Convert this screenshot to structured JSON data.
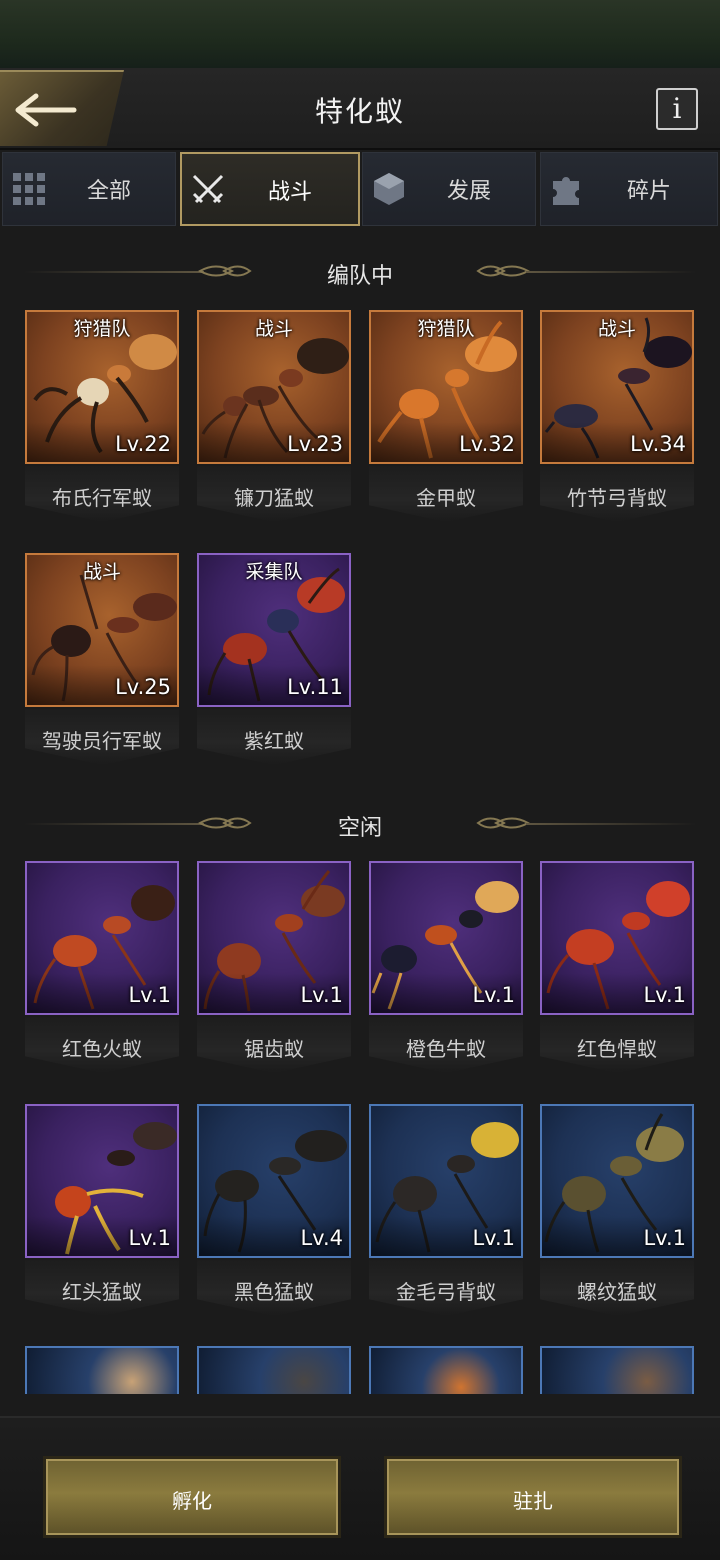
{
  "header": {
    "title": "特化蚁",
    "info_label": "i",
    "back_icon": "back-arrow-icon"
  },
  "tabs": [
    {
      "label": "全部",
      "icon": "grid-icon",
      "active": false
    },
    {
      "label": "战斗",
      "icon": "crossed-swords-icon",
      "active": true
    },
    {
      "label": "发展",
      "icon": "cube-icon",
      "active": false
    },
    {
      "label": "碎片",
      "icon": "puzzle-icon",
      "active": false
    }
  ],
  "sections": {
    "in_team": {
      "title": "编队中"
    },
    "idle": {
      "title": "空闲"
    }
  },
  "in_team_ants": [
    {
      "tag": "狩猎队",
      "level": "Lv.22",
      "name": "布氏行军蚁",
      "rarity": "orange"
    },
    {
      "tag": "战斗",
      "level": "Lv.23",
      "name": "镰刀猛蚁",
      "rarity": "orange"
    },
    {
      "tag": "狩猎队",
      "level": "Lv.32",
      "name": "金甲蚁",
      "rarity": "orange"
    },
    {
      "tag": "战斗",
      "level": "Lv.34",
      "name": "竹节弓背蚁",
      "rarity": "orange"
    },
    {
      "tag": "战斗",
      "level": "Lv.25",
      "name": "驾驶员行军蚁",
      "rarity": "orange"
    },
    {
      "tag": "采集队",
      "level": "Lv.11",
      "name": "紫红蚁",
      "rarity": "purple"
    }
  ],
  "idle_ants": [
    {
      "level": "Lv.1",
      "name": "红色火蚁",
      "rarity": "purple"
    },
    {
      "level": "Lv.1",
      "name": "锯齿蚁",
      "rarity": "purple"
    },
    {
      "level": "Lv.1",
      "name": "橙色牛蚁",
      "rarity": "purple"
    },
    {
      "level": "Lv.1",
      "name": "红色悍蚁",
      "rarity": "purple"
    },
    {
      "level": "Lv.1",
      "name": "红头猛蚁",
      "rarity": "purple"
    },
    {
      "level": "Lv.4",
      "name": "黑色猛蚁",
      "rarity": "blue"
    },
    {
      "level": "Lv.1",
      "name": "金毛弓背蚁",
      "rarity": "blue"
    },
    {
      "level": "Lv.1",
      "name": "螺纹猛蚁",
      "rarity": "blue"
    }
  ],
  "footer": {
    "hatch_label": "孵化",
    "station_label": "驻扎"
  },
  "colors": {
    "rarity_orange": "#c57a3c",
    "rarity_purple": "#8a62c4",
    "rarity_blue": "#4c78b6",
    "gold": "#b19a62"
  }
}
